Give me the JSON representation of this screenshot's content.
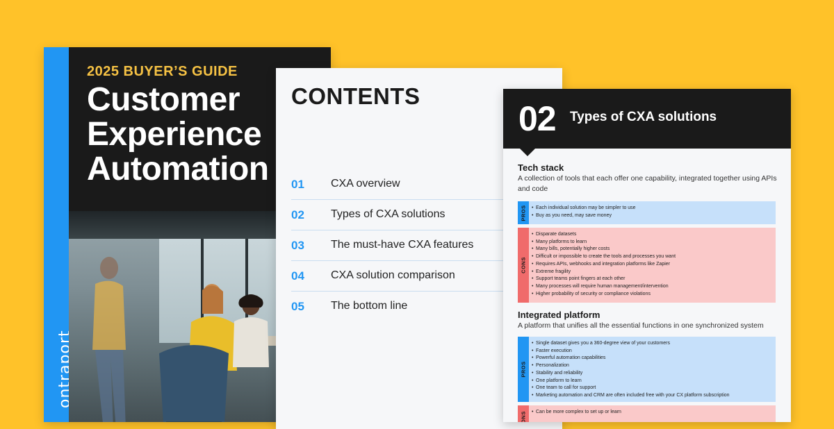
{
  "cover": {
    "guide_label": "2025 BUYER’S GUIDE",
    "title_lines": [
      "Customer",
      "Experience",
      "Automation"
    ],
    "brand": "ontraport",
    "colors": {
      "background": "#1A1A1A",
      "stripe": "#2196F3",
      "guide_label": "#F6C244"
    }
  },
  "contents": {
    "title": "CONTENTS",
    "items": [
      {
        "num": "01",
        "label": "CXA overview"
      },
      {
        "num": "02",
        "label": "Types of CXA solutions"
      },
      {
        "num": "03",
        "label": "The must-have CXA features"
      },
      {
        "num": "04",
        "label": "CXA solution comparison"
      },
      {
        "num": "05",
        "label": "The bottom line"
      }
    ]
  },
  "types": {
    "section_num": "02",
    "section_title": "Types of CXA solutions",
    "tech_stack": {
      "heading": "Tech stack",
      "description": "A collection of tools that each offer one capability, integrated together using APIs and code",
      "pros_label": "PROS",
      "pros": [
        "Each individual solution may be simpler to use",
        "Buy as you need, may save money"
      ],
      "cons_label": "CONS",
      "cons": [
        "Disparate datasets",
        "Many platforms to learn",
        "Many bills, potentially higher costs",
        "Difficult or impossible to create the tools and processes you want",
        "Requires APIs, webhooks and integration platforms like Zapier",
        "Extreme fragility",
        "Support teams point fingers at each other",
        "Many processes will require human management/intervention",
        "Higher probability of security or compliance violations"
      ]
    },
    "integrated_platform": {
      "heading": "Integrated platform",
      "description": "A platform that unifies all the essential functions in one synchronized system",
      "pros_label": "PROS",
      "pros": [
        "Single dataset gives you a 360-degree view of your customers",
        "Faster execution",
        "Powerful automation capabilities",
        "Personalization",
        "Stability and reliability",
        "One platform to learn",
        "One team to call for support",
        "Marketing automation and CRM are often included free with your CX platform subscription"
      ],
      "cons_label": "CONS",
      "cons": [
        "Can be more complex to set up or learn"
      ]
    }
  },
  "colors": {
    "background": "#FFC229",
    "accent": "#2196F3",
    "pros": "#C6E0FA",
    "cons": "#FAC9C9"
  }
}
